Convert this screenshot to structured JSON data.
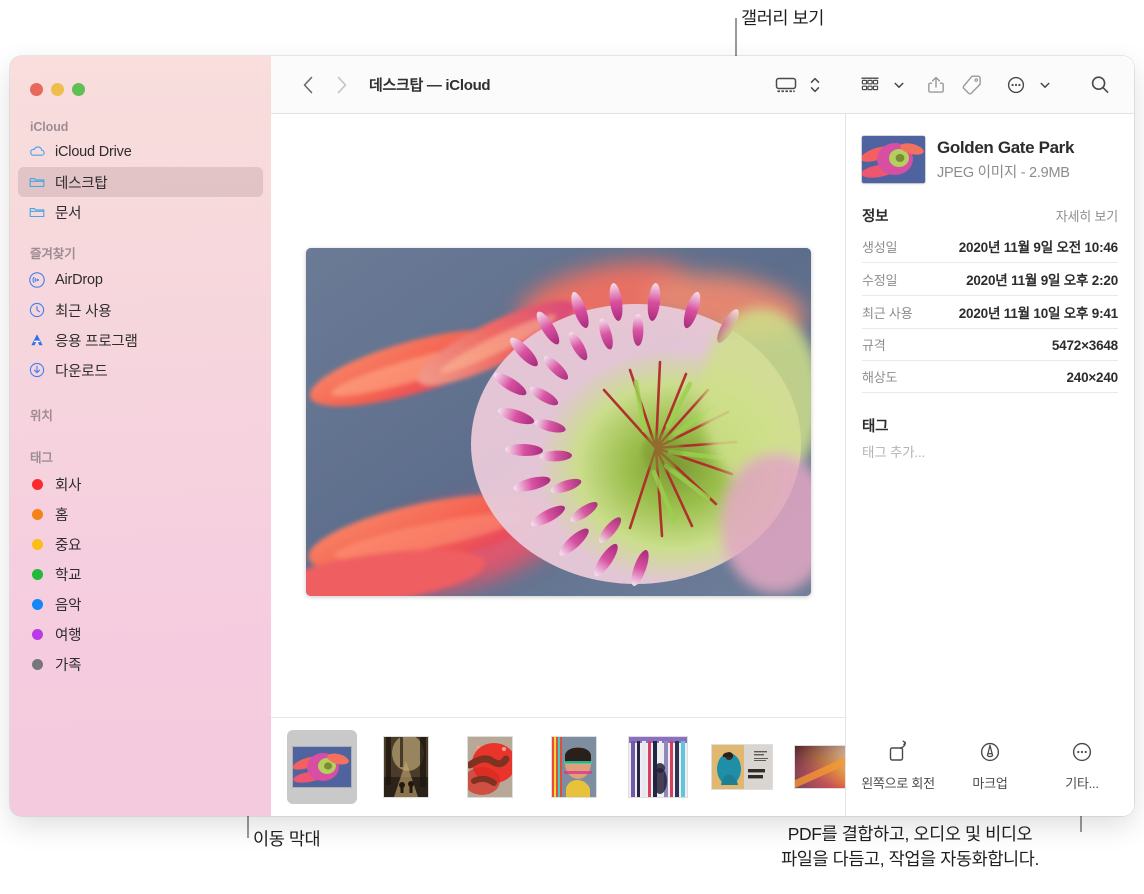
{
  "window": {
    "traffic_lights": [
      {
        "name": "close",
        "color": "#e8695c"
      },
      {
        "name": "minimize",
        "color": "#efbd4e"
      },
      {
        "name": "zoom",
        "color": "#5fc055"
      }
    ]
  },
  "sidebar": {
    "sections": [
      {
        "header": "iCloud",
        "items": [
          {
            "label": "iCloud Drive",
            "icon": "cloud-icon",
            "selected": false
          },
          {
            "label": "데스크탑",
            "icon": "folder-icon",
            "selected": true
          },
          {
            "label": "문서",
            "icon": "folder-icon",
            "selected": false
          }
        ]
      },
      {
        "header": "즐겨찾기",
        "items": [
          {
            "label": "AirDrop",
            "icon": "airdrop-icon",
            "selected": false
          },
          {
            "label": "최근 사용",
            "icon": "clock-icon",
            "selected": false
          },
          {
            "label": "응용 프로그램",
            "icon": "applications-icon",
            "selected": false
          },
          {
            "label": "다운로드",
            "icon": "download-icon",
            "selected": false
          }
        ]
      },
      {
        "header": "위치",
        "items": []
      },
      {
        "header": "태그",
        "items": [
          {
            "label": "회사",
            "icon": "tag-dot-icon",
            "color": "#fb2a2c"
          },
          {
            "label": "홈",
            "icon": "tag-dot-icon",
            "color": "#f58216"
          },
          {
            "label": "중요",
            "icon": "tag-dot-icon",
            "color": "#fbbd18"
          },
          {
            "label": "학교",
            "icon": "tag-dot-icon",
            "color": "#21ba3a"
          },
          {
            "label": "음악",
            "icon": "tag-dot-icon",
            "color": "#1585f7"
          },
          {
            "label": "여행",
            "icon": "tag-dot-icon",
            "color": "#b93ae6"
          },
          {
            "label": "가족",
            "icon": "tag-dot-icon",
            "color": "#76767d"
          }
        ]
      }
    ]
  },
  "toolbar": {
    "back_icon": "chevron-left-icon",
    "forward_icon": "chevron-right-icon",
    "title": "데스크탑 — iCloud",
    "buttons": [
      {
        "name": "gallery-view-button",
        "icon": "gallery-view-icon"
      },
      {
        "name": "view-options-stepper",
        "icon": "chevron-updown-icon"
      },
      {
        "name": "group-by-button",
        "icon": "grid-group-icon"
      },
      {
        "name": "group-by-chevron",
        "icon": "chevron-down-icon"
      },
      {
        "name": "share-button",
        "icon": "share-icon"
      },
      {
        "name": "tag-button",
        "icon": "tag-icon"
      },
      {
        "name": "more-actions-button",
        "icon": "ellipsis-circle-icon"
      },
      {
        "name": "more-actions-chevron",
        "icon": "chevron-down-icon"
      },
      {
        "name": "search-button",
        "icon": "search-icon"
      }
    ]
  },
  "gallery": {
    "selected_photo_alt": "golden-gate-park-flower-macro",
    "thumbnails": [
      {
        "name": "flower-macro",
        "selected": true,
        "orientation": "landscape"
      },
      {
        "name": "forest-path-people",
        "selected": false,
        "orientation": "portrait"
      },
      {
        "name": "red-powder-hands",
        "selected": false,
        "orientation": "portrait"
      },
      {
        "name": "portrait-neon-stripes",
        "selected": false,
        "orientation": "portrait"
      },
      {
        "name": "striped-curtain-figure",
        "selected": false,
        "orientation": "portrait"
      },
      {
        "name": "louisa-farris-poster",
        "selected": false,
        "orientation": "landscape"
      },
      {
        "name": "orange-gradient-abstract",
        "selected": false,
        "orientation": "landscape"
      },
      {
        "name": "marketing-plan-fall-2019",
        "selected": false,
        "orientation": "portrait"
      }
    ]
  },
  "inspector": {
    "file": {
      "name": "Golden Gate Park",
      "kind_and_size": "JPEG 이미지 - 2.9MB"
    },
    "info": {
      "title": "정보",
      "more_link": "자세히 보기",
      "rows": [
        {
          "key": "생성일",
          "value": "2020년 11월 9일 오전 10:46"
        },
        {
          "key": "수정일",
          "value": "2020년 11월 9일 오후 2:20"
        },
        {
          "key": "최근 사용",
          "value": "2020년 11월 10일 오후 9:41"
        },
        {
          "key": "규격",
          "value": "5472×3648"
        },
        {
          "key": "해상도",
          "value": "240×240"
        }
      ]
    },
    "tags": {
      "title": "태그",
      "placeholder": "태그 추가..."
    },
    "actions": [
      {
        "label": "왼쪽으로 회전",
        "icon": "rotate-left-icon"
      },
      {
        "label": "마크업",
        "icon": "markup-icon"
      },
      {
        "label": "기타...",
        "icon": "ellipsis-circle-icon"
      }
    ]
  },
  "callouts": {
    "gallery_view": "갤러리 보기",
    "move_bar": "이동 막대",
    "pdf_line1": "PDF를 결합하고, 오디오 및 비디오",
    "pdf_line2": "파일을 다듬고, 작업을 자동화합니다."
  }
}
